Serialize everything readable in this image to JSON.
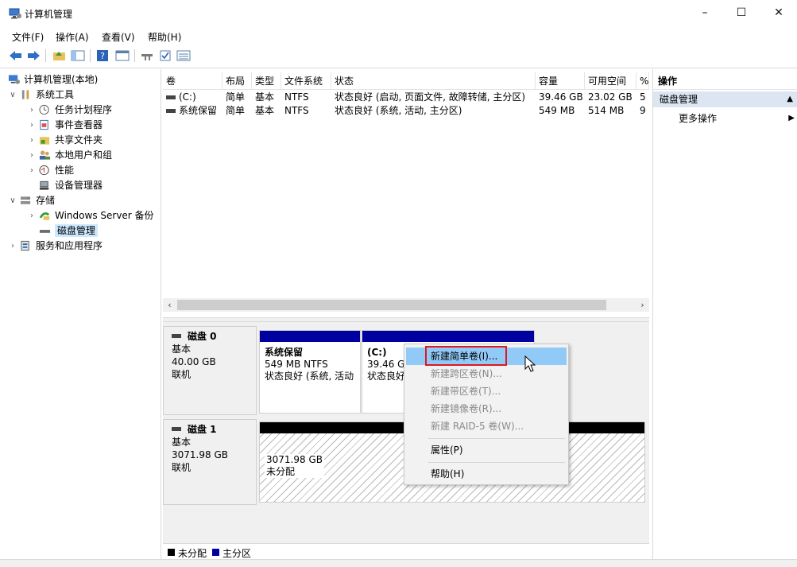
{
  "window": {
    "title": "计算机管理",
    "minimize": "–",
    "maximize": "☐",
    "close": "✕"
  },
  "menu": [
    "文件(F)",
    "操作(A)",
    "查看(V)",
    "帮助(H)"
  ],
  "tree": {
    "root": "计算机管理(本地)",
    "system_tools": "系统工具",
    "task_scheduler": "任务计划程序",
    "event_viewer": "事件查看器",
    "shared_folders": "共享文件夹",
    "local_users": "本地用户和组",
    "performance": "性能",
    "device_manager": "设备管理器",
    "storage": "存储",
    "windows_backup": "Windows Server 备份",
    "disk_management": "磁盘管理",
    "services_apps": "服务和应用程序"
  },
  "volume_table": {
    "headers": [
      "卷",
      "布局",
      "类型",
      "文件系统",
      "状态",
      "容量",
      "可用空间",
      "%"
    ],
    "rows": [
      [
        "(C:)",
        "简单",
        "基本",
        "NTFS",
        "状态良好 (启动, 页面文件, 故障转储, 主分区)",
        "39.46 GB",
        "23.02 GB",
        "5"
      ],
      [
        "系统保留",
        "简单",
        "基本",
        "NTFS",
        "状态良好 (系统, 活动, 主分区)",
        "549 MB",
        "514 MB",
        "9"
      ]
    ]
  },
  "disks": [
    {
      "name": "磁盘 0",
      "type": "基本",
      "size": "40.00 GB",
      "status": "联机",
      "partitions": [
        {
          "name": "系统保留",
          "line1": "549 MB NTFS",
          "line2": "状态良好 (系统, 活动"
        },
        {
          "name": "(C:)",
          "line1": "39.46 G",
          "line2": "状态良好"
        }
      ]
    },
    {
      "name": "磁盘 1",
      "type": "基本",
      "size": "3071.98 GB",
      "status": "联机",
      "partitions": [
        {
          "line1": "3071.98 GB",
          "line2": "未分配"
        }
      ]
    }
  ],
  "legend": {
    "unallocated": "未分配",
    "primary": "主分区",
    "unallocated_color": "#000000",
    "primary_color": "#0000a0"
  },
  "actions": {
    "header": "操作",
    "section": "磁盘管理",
    "more": "更多操作"
  },
  "context_menu": {
    "items": [
      {
        "label": "新建简单卷(I)...",
        "enabled": true,
        "highlighted": true
      },
      {
        "label": "新建跨区卷(N)...",
        "enabled": false
      },
      {
        "label": "新建带区卷(T)...",
        "enabled": false
      },
      {
        "label": "新建镜像卷(R)...",
        "enabled": false
      },
      {
        "label": "新建 RAID-5 卷(W)...",
        "enabled": false
      },
      {
        "label": "属性(P)",
        "enabled": true
      },
      {
        "label": "帮助(H)",
        "enabled": true
      }
    ]
  },
  "colors": {
    "primary_partition_bar": "#0000a0",
    "unallocated_bar": "#000000",
    "menu_highlight": "#91c9f7",
    "callout_red": "#e0181e",
    "actions_section_bg": "#dbe6f2"
  }
}
